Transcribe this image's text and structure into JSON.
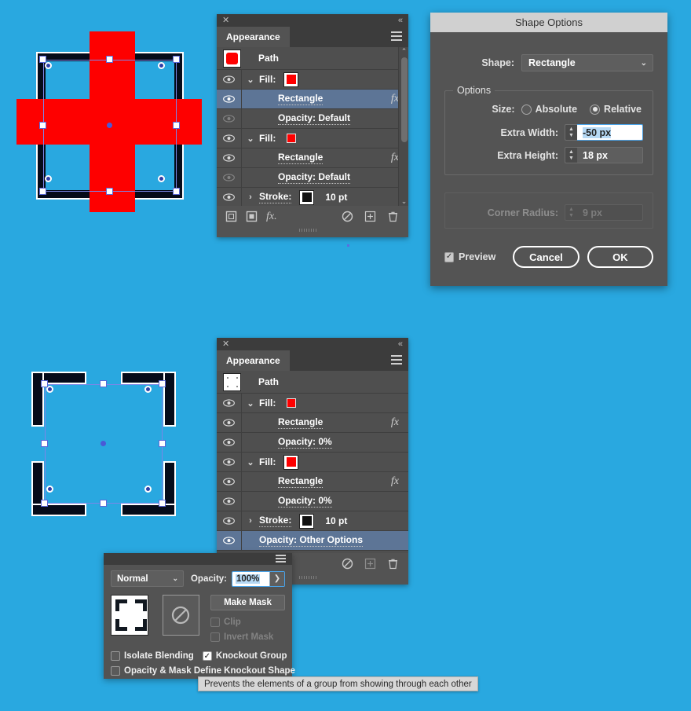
{
  "app": {
    "background_color": "#29a8e0",
    "red": "#fe0000",
    "dark": "#050b1a"
  },
  "appearance_panel_1": {
    "close_icon": "close-icon",
    "collapse_icon": "collapse-icon",
    "tab_label": "Appearance",
    "menu_icon": "panel-menu-icon",
    "path_label": "Path",
    "rows": [
      {
        "label": "Fill:",
        "type": "fill",
        "swatch": "#fe0000",
        "visible": true,
        "disclosure": "down",
        "selected": false,
        "fx": false
      },
      {
        "label": "Rectangle",
        "type": "effect",
        "visible": true,
        "selected": true,
        "fx": true,
        "underline": true
      },
      {
        "label": "Opacity: Default",
        "type": "opacity",
        "visible": false,
        "selected": false,
        "fx": false,
        "underline": true
      },
      {
        "label": "Fill:",
        "type": "fill",
        "swatch": "#fe0000",
        "visible": true,
        "disclosure": "down",
        "selected": false,
        "fx": false
      },
      {
        "label": "Rectangle",
        "type": "effect",
        "visible": true,
        "selected": false,
        "fx": true,
        "underline": true
      },
      {
        "label": "Opacity: Default",
        "type": "opacity",
        "visible": false,
        "selected": false,
        "fx": false,
        "underline": true
      },
      {
        "label": "Stroke:",
        "type": "stroke",
        "value": "10 pt",
        "visible": true,
        "disclosure": "right",
        "selected": false,
        "fx": false,
        "underline": true
      }
    ],
    "footer_icons": [
      "add-new-stroke-icon",
      "add-new-fill-icon",
      "add-new-effect-icon",
      "clear-appearance-icon",
      "duplicate-item-icon",
      "delete-item-icon"
    ]
  },
  "appearance_panel_2": {
    "close_icon": "close-icon",
    "collapse_icon": "collapse-icon",
    "tab_label": "Appearance",
    "menu_icon": "panel-menu-icon",
    "path_label": "Path",
    "rows": [
      {
        "label": "Fill:",
        "type": "fill",
        "swatch": "#fe0000",
        "visible": true,
        "disclosure": "down",
        "selected": false,
        "fx": false
      },
      {
        "label": "Rectangle",
        "type": "effect",
        "visible": true,
        "selected": false,
        "fx": true,
        "underline": true
      },
      {
        "label": "Opacity: 0%",
        "type": "opacity",
        "visible": true,
        "selected": false,
        "fx": false,
        "underline": true
      },
      {
        "label": "Fill:",
        "type": "fill",
        "swatch": "#fe0000",
        "visible": true,
        "disclosure": "down",
        "selected": false,
        "fx": false
      },
      {
        "label": "Rectangle",
        "type": "effect",
        "visible": true,
        "selected": false,
        "fx": true,
        "underline": true
      },
      {
        "label": "Opacity: 0%",
        "type": "opacity",
        "visible": true,
        "selected": false,
        "fx": false,
        "underline": true
      },
      {
        "label": "Stroke:",
        "type": "stroke",
        "value": "10 pt",
        "visible": true,
        "disclosure": "right",
        "selected": false,
        "fx": false,
        "underline": true
      },
      {
        "label": "Opacity: Other Options",
        "type": "opacity",
        "visible": true,
        "selected": true,
        "fx": false,
        "underline": true
      }
    ],
    "footer_icons": [
      "clear-appearance-icon",
      "duplicate-item-icon",
      "delete-item-icon"
    ]
  },
  "shape_options_dialog": {
    "title": "Shape Options",
    "shape_label": "Shape:",
    "shape_value": "Rectangle",
    "options_legend": "Options",
    "size_label": "Size:",
    "size_absolute": "Absolute",
    "size_relative": "Relative",
    "size_selected": "Relative",
    "extra_width_label": "Extra Width:",
    "extra_width_value": "-50 px",
    "extra_height_label": "Extra Height:",
    "extra_height_value": "18 px",
    "corner_radius_label": "Corner Radius:",
    "corner_radius_value": "9 px",
    "corner_radius_enabled": false,
    "preview_label": "Preview",
    "preview_checked": true,
    "cancel_label": "Cancel",
    "ok_label": "OK"
  },
  "transparency_panel": {
    "menu_icon": "panel-menu-icon",
    "blend_mode": "Normal",
    "opacity_label": "Opacity:",
    "opacity_value": "100%",
    "go_icon": "chevron-right-icon",
    "artwork_thumb": "artwork-thumbnail",
    "mask_thumb": "no-mask-icon",
    "make_mask_label": "Make Mask",
    "clip_label": "Clip",
    "clip_checked": false,
    "invert_mask_label": "Invert Mask",
    "invert_mask_checked": false,
    "isolate_blending_label": "Isolate Blending",
    "isolate_blending_checked": false,
    "knockout_group_label": "Knockout Group",
    "knockout_group_checked": true,
    "opacity_mask_label": "Opacity & Mask Define Knockout Shape",
    "opacity_mask_checked": false
  },
  "tooltip": {
    "text": "Prevents the elements of a group from showing through each other"
  },
  "canvas_opacity_popup": {
    "opacity_value": "100%"
  }
}
